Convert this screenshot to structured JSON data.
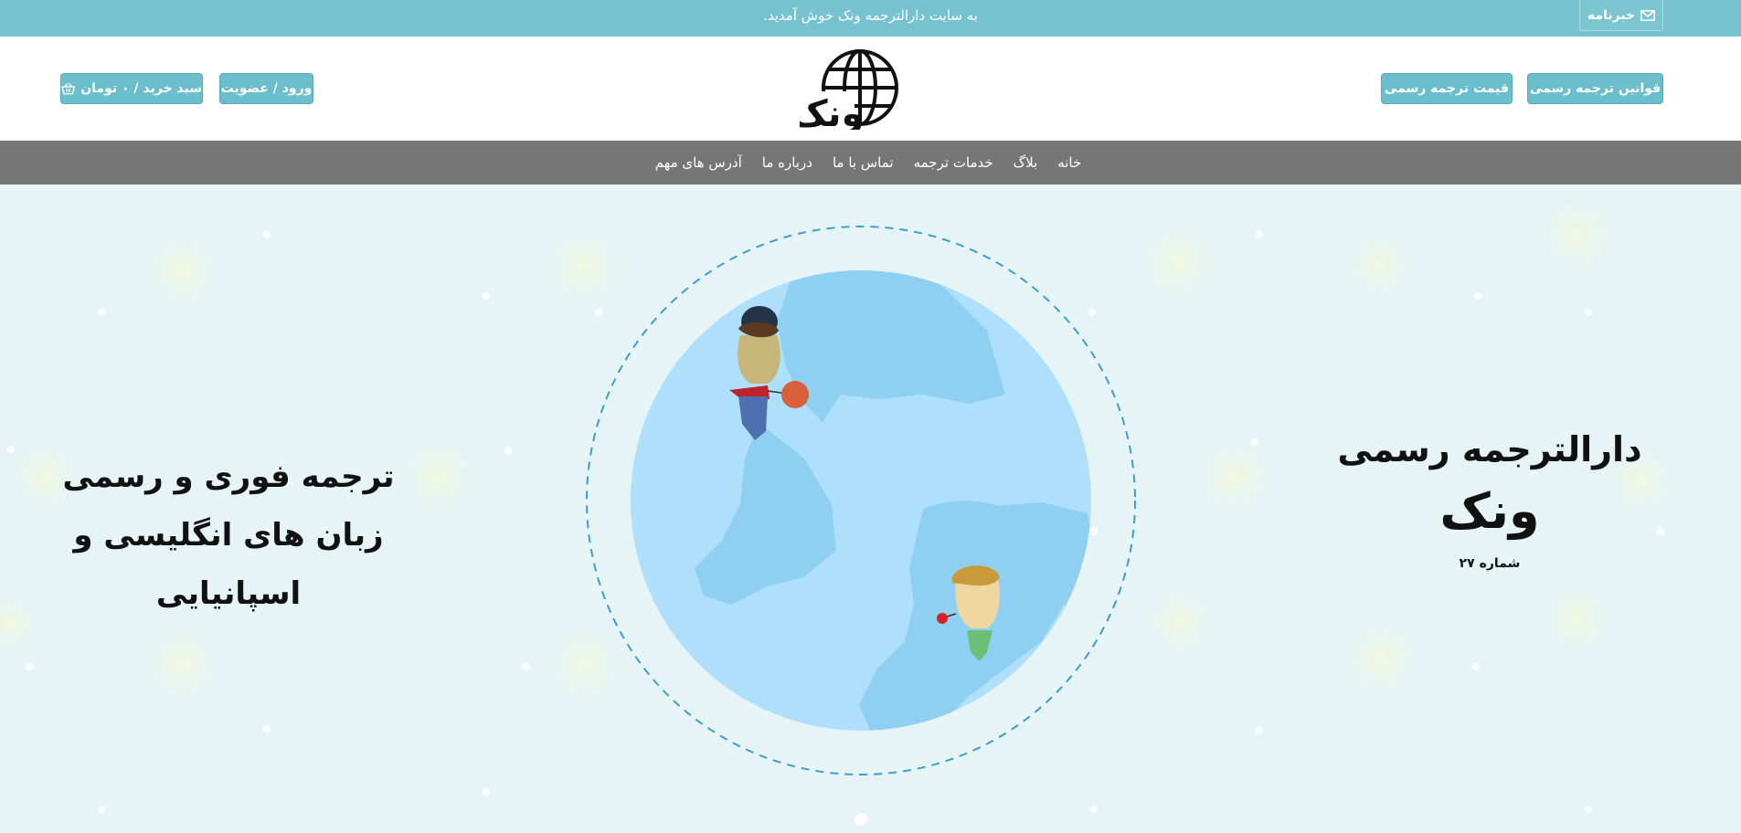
{
  "topbar": {
    "welcome_text": "به سایت دارالترجمه ونک خوش آمدید.",
    "newsletter_label": "خبرنامه",
    "newsletter_icon": "envelope-icon"
  },
  "header": {
    "buttons": {
      "translation_rules": "قوانین ترجمه رسمی",
      "translation_price": "قیمت ترجمه رسمی",
      "login_register": "ورود / عضویت",
      "cart": "سبد خرید / ۰ تومان"
    },
    "cart_icon": "basket-icon",
    "logo_text": "ونک",
    "logo_icon": "globe-icon"
  },
  "nav": {
    "items": [
      "خانه",
      "بلاگ",
      "خدمات ترجمه",
      "تماس با ما",
      "درباره ما",
      "آدرس های مهم"
    ]
  },
  "hero": {
    "right": {
      "line1": "دارالترجمه رسمی",
      "line2": "ونک",
      "line3": "شماره ۲۷"
    },
    "left": {
      "line1": "ترجمه فوری و رسمی",
      "line2": "زبان های انگلیسی و اسپانیایی"
    }
  },
  "colors": {
    "topbar": "#76c3cf",
    "button": "#6bbfcc",
    "navbar": "#767676",
    "hero_bg": "#e6f4f5",
    "globe": "#aee0fb",
    "globe_land": "#8fd0f2",
    "ring": "#3a9ed0"
  }
}
